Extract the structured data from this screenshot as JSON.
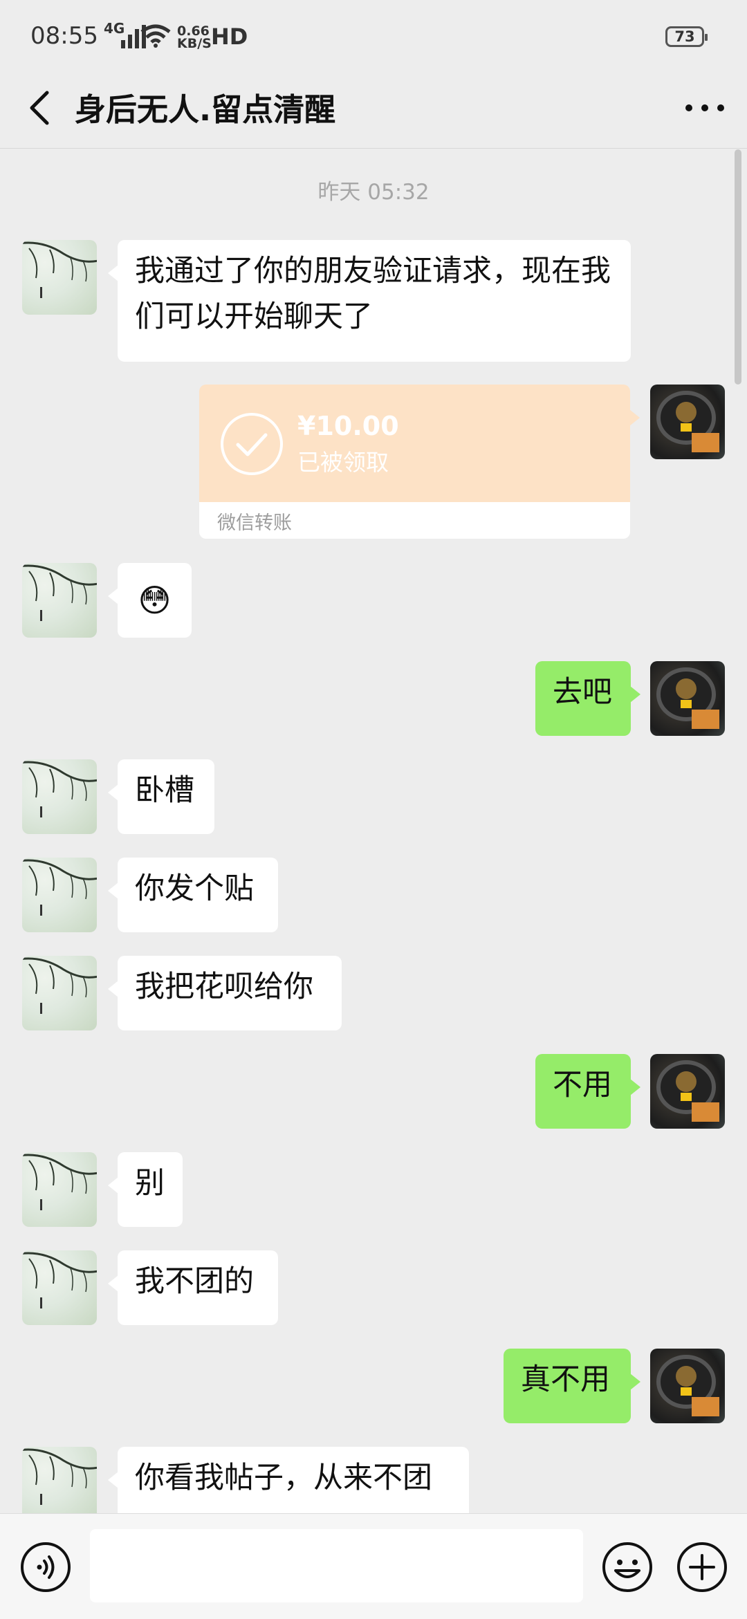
{
  "status_bar": {
    "time": "08:55",
    "network": "4G",
    "speed": "0.66",
    "speed_unit": "KB/S",
    "hd": "HD",
    "battery": "73"
  },
  "header": {
    "title": "身后无人.留点清醒"
  },
  "timestamp": "昨天 05:32",
  "messages": [
    {
      "from": "other",
      "text": "我通过了你的朋友验证请求，现在我们可以开始聊天了"
    },
    {
      "from": "me",
      "type": "transfer",
      "amount": "¥10.00",
      "status": "已被领取",
      "label": "微信转账"
    },
    {
      "from": "other",
      "type": "emoji",
      "emoji": "😳"
    },
    {
      "from": "me",
      "text": "去吧"
    },
    {
      "from": "other",
      "text": "卧槽"
    },
    {
      "from": "other",
      "text": "你发个贴"
    },
    {
      "from": "other",
      "text": "我把花呗给你"
    },
    {
      "from": "me",
      "text": "不用"
    },
    {
      "from": "other",
      "text": "别"
    },
    {
      "from": "other",
      "text": "我不团的"
    },
    {
      "from": "me",
      "text": "真不用"
    },
    {
      "from": "other",
      "text": "你看我帖子，从来不团"
    }
  ],
  "colors": {
    "bg": "#ededed",
    "bubble_out": "#95ec69",
    "bubble_in": "#ffffff",
    "transfer": "#fde2c6"
  },
  "icons": {
    "back": "chevron-left",
    "more": "ellipsis-horizontal",
    "voice": "voice-waves",
    "emoji": "smiley-face",
    "plus": "plus-circle",
    "transfer": "check-circle"
  }
}
